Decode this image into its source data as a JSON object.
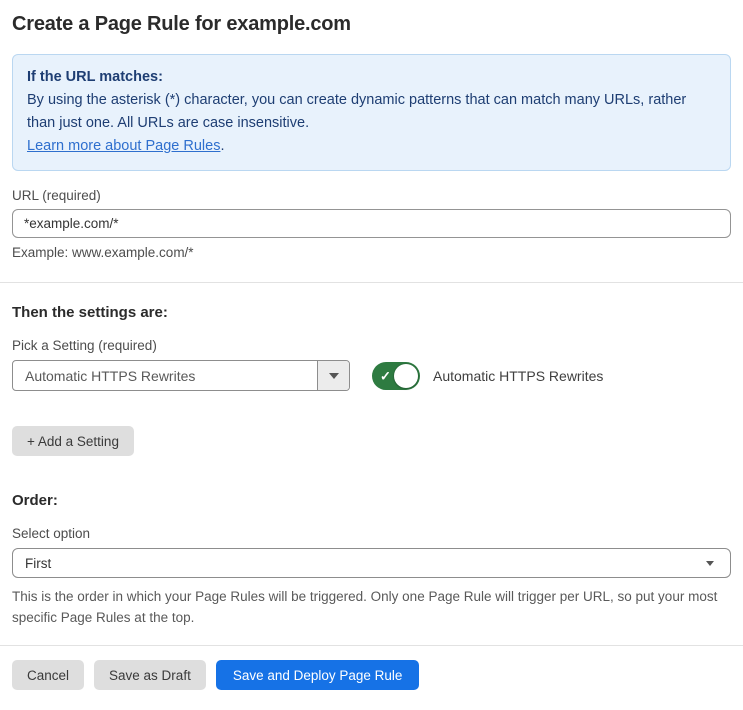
{
  "page": {
    "title": "Create a Page Rule for example.com"
  },
  "info_box": {
    "heading": "If the URL matches:",
    "body": "By using the asterisk (*) character, you can create dynamic patterns that can match many URLs, rather than just one. All URLs are case insensitive.",
    "link_label": "Learn more about Page Rules",
    "link_suffix": "."
  },
  "url_field": {
    "label": "URL (required)",
    "value": "*example.com/*",
    "helper": "Example: www.example.com/*"
  },
  "settings_section": {
    "heading": "Then the settings are:",
    "picker_label": "Pick a Setting (required)",
    "picker_value": "Automatic HTTPS Rewrites",
    "toggle": {
      "state": "on",
      "label": "Automatic HTTPS Rewrites"
    },
    "add_button_label": "+ Add a Setting"
  },
  "order_section": {
    "heading": "Order:",
    "select_label": "Select option",
    "select_value": "First",
    "helper": "This is the order in which your Page Rules will be triggered. Only one Page Rule will trigger per URL, so put your most specific Page Rules at the top."
  },
  "footer": {
    "cancel_label": "Cancel",
    "save_draft_label": "Save as Draft",
    "save_deploy_label": "Save and Deploy Page Rule"
  },
  "colors": {
    "info_box_background": "#e8f2fc",
    "info_box_border": "#bad7f1",
    "info_box_text": "#1e3e73",
    "link_blue": "#2e6fce",
    "toggle_green": "#2e7b41",
    "primary_button_blue": "#1672e6",
    "gray_button": "#dedede",
    "divider": "#e2e2e2"
  }
}
